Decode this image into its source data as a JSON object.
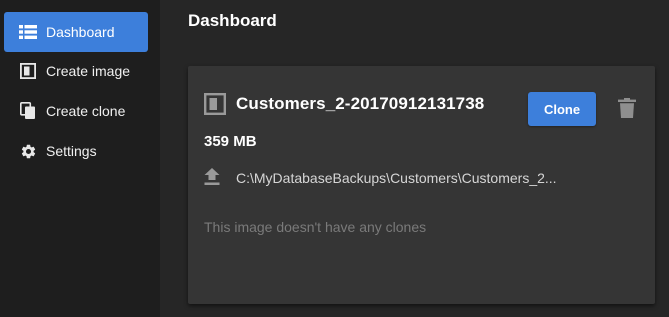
{
  "sidebar": {
    "items": [
      {
        "label": "Dashboard",
        "icon": "list-icon",
        "active": true
      },
      {
        "label": "Create image",
        "icon": "image-icon",
        "active": false
      },
      {
        "label": "Create clone",
        "icon": "copy-icon",
        "active": false
      },
      {
        "label": "Settings",
        "icon": "gear-icon",
        "active": false
      }
    ]
  },
  "header": {
    "title": "Dashboard"
  },
  "image_card": {
    "icon": "image-icon",
    "name": "Customers_2-20170912131738",
    "clone_label": "Clone",
    "delete_icon": "trash-icon",
    "size": "359 MB",
    "path_icon": "upload-icon",
    "path": "C:\\MyDatabaseBackups\\Customers\\Customers_2...",
    "empty_message": "This image doesn't have any clones"
  },
  "colors": {
    "accent": "#3d7fdb",
    "sidebar_bg": "#1e1e1e",
    "page_bg": "#262626",
    "card_bg": "#353535",
    "muted_text": "#7a7a7a"
  }
}
